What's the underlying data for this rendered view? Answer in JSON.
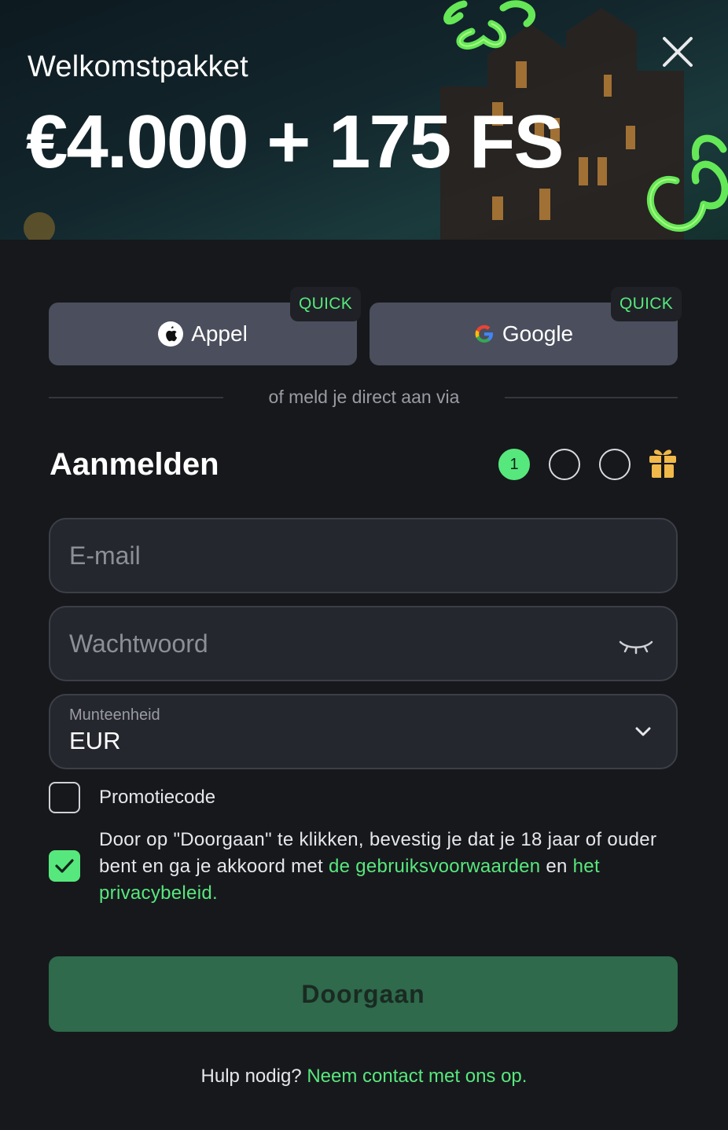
{
  "hero": {
    "eyebrow": "Welkomstpakket",
    "amount": "€4.000 + 175 FS"
  },
  "social": {
    "apple_label": "Appel",
    "google_label": "Google",
    "quick_badge": "QUICK"
  },
  "divider_text": "of meld je direct aan via",
  "signup": {
    "title": "Aanmelden",
    "steps": [
      "1",
      "",
      ""
    ],
    "active_step": 1
  },
  "form": {
    "email_placeholder": "E-mail",
    "password_placeholder": "Wachtwoord",
    "currency_label": "Munteenheid",
    "currency_value": "EUR",
    "promo_label": "Promotiecode",
    "promo_checked": false,
    "terms_checked": true,
    "terms_prefix": "Door op \"Doorgaan\" te klikken, bevestig je dat je 18 jaar of ouder bent en ga je akkoord met ",
    "terms_link": "de gebruiksvoorwaarden",
    "terms_and": " en ",
    "privacy_link": "het privacybeleid."
  },
  "cta_label": "Doorgaan",
  "help": {
    "prefix": "Hulp nodig? ",
    "link": "Neem contact met ons op."
  },
  "colors": {
    "accent_green": "#57e87d",
    "background": "#17181c",
    "button_gray": "#4b4e5c",
    "cta_green": "#2e6a4b"
  }
}
